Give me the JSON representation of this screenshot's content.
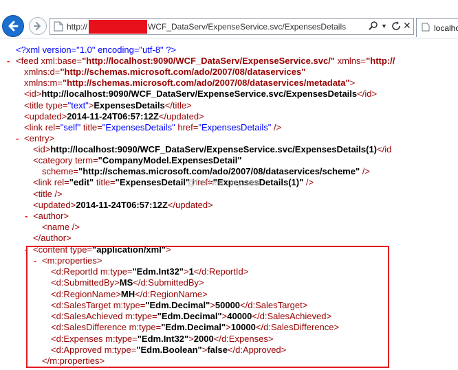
{
  "browser": {
    "url_prefix": "http://",
    "url_rest": "WCF_DataServ/ExpenseService.svc/ExpensesDetails",
    "tab_title": "localhost",
    "icons": [
      "back-arrow-icon",
      "forward-arrow-icon",
      "page-icon",
      "search-icon",
      "dropdown-icon",
      "refresh-icon",
      "stop-icon",
      "tab-favicon-icon"
    ]
  },
  "xml": {
    "pi": "<?xml version=\"1.0\" encoding=\"utf-8\" ?>",
    "feed_open": "<feed",
    "feed_base_attr": " xml:base=",
    "feed_base_val": "\"http://localhost:9090/WCF_DataServ/ExpenseService.svc/\"",
    "feed_xmlns_attr": " xmlns=",
    "feed_xmlns_val": "\"http://",
    "xmlns_d_attr": "xmlns:d=",
    "xmlns_d_val": "\"http://schemas.microsoft.com/ado/2007/08/dataservices\"",
    "xmlns_m_attr": "xmlns:m=",
    "xmlns_m_val": "\"http://schemas.microsoft.com/ado/2007/08/dataservices/metadata\"",
    "feed_close_bracket": ">",
    "id_open": "<id>",
    "id_text": "http://localhost:9090/WCF_DataServ/ExpenseService.svc/ExpensesDetails",
    "id_close": "</id>",
    "title_open": "<title",
    "title_type_attr": " type=",
    "title_type_val": "\"text\"",
    "title_gt": ">",
    "title_text": "ExpensesDetails",
    "title_close": "</title>",
    "updated_open": "<updated>",
    "updated_text": "2014-11-24T06:57:12Z",
    "updated_close": "</updated>",
    "link_open": "<link",
    "link_rel_attr": " rel=",
    "link_rel_val": "\"self\"",
    "link_title_attr": " title=",
    "link_title_val": "\"ExpensesDetails\"",
    "link_href_attr": " href=",
    "link_href_val": "\"ExpensesDetails\"",
    "link_end": " />",
    "entry_open": "<entry>",
    "entry_id_text": "http://localhost:9090/WCF_DataServ/ExpenseService.svc/ExpensesDetails(1)",
    "entry_id_close": "</id",
    "category_open": "<category",
    "category_term_attr": " term=",
    "category_term_val": "\"CompanyModel.ExpensesDetail\"",
    "category_scheme_attr": "scheme=",
    "category_scheme_val": "\"http://schemas.microsoft.com/ado/2007/08/dataservices/scheme\"",
    "category_end": " />",
    "link2_rel_val": "\"edit\"",
    "link2_title_val": "\"ExpensesDetail\"",
    "link2_href_val": "\"ExpensesDetails(1)\"",
    "title_selfclose": "<title />",
    "author_open": "<author>",
    "name_selfclose": "<name />",
    "author_close": "</author>",
    "content_open": "<content",
    "content_type_attr": " type=",
    "content_type_val": "\"application/xml\"",
    "content_gt": ">",
    "mprops_open": "<m:properties>",
    "mprops_close": "</m:properties>",
    "mtype_attr": " m:type=",
    "properties": [
      {
        "tag": "d:ReportId",
        "type": "\"Edm.Int32\"",
        "value": "1"
      },
      {
        "tag": "d:SubmittedBy",
        "type": "",
        "value": "MS"
      },
      {
        "tag": "d:RegionName",
        "type": "",
        "value": "MH"
      },
      {
        "tag": "d:SalesTarget",
        "type": "\"Edm.Decimal\"",
        "value": "50000"
      },
      {
        "tag": "d:SalesAchieved",
        "type": "\"Edm.Decimal\"",
        "value": "40000"
      },
      {
        "tag": "d:SalesDifference",
        "type": "\"Edm.Decimal\"",
        "value": "10000"
      },
      {
        "tag": "d:Expenses",
        "type": "\"Edm.Int32\"",
        "value": "2000"
      },
      {
        "tag": "d:Approved",
        "type": "\"Edm.Boolean\"",
        "value": "false"
      }
    ],
    "minus": "-",
    "watermark": "@DotNetCurry.com"
  },
  "colors": {
    "markup": "#990000",
    "value": "#0000ff",
    "minus": "#ff0000",
    "highlight_box": "#e21b24",
    "redaction": "#e8101a",
    "back_button": "#1a6fcf"
  }
}
